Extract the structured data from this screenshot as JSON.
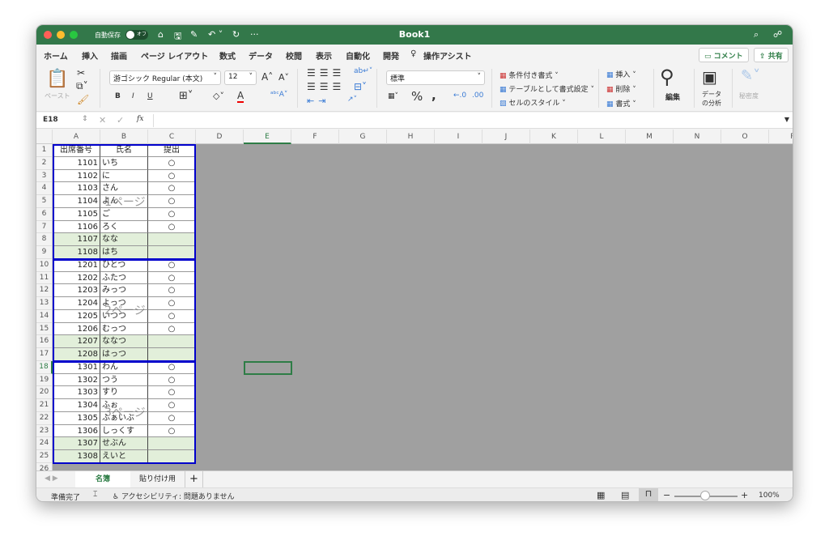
{
  "window": {
    "title": "Book1",
    "autosave_label": "自動保存",
    "autosave_state": "オフ"
  },
  "tabs": [
    "ホーム",
    "挿入",
    "描画",
    "ページ レイアウト",
    "数式",
    "データ",
    "校閲",
    "表示",
    "自動化",
    "開発",
    "操作アシスト"
  ],
  "actions": {
    "comment": "コメント",
    "share": "共有"
  },
  "ribbon": {
    "paste": "ペースト",
    "font": "游ゴシック Regular (本文)",
    "size": "12",
    "number_format": "標準",
    "conditional": "条件付き書式",
    "table": "テーブルとして書式設定",
    "cell_style": "セルのスタイル",
    "insert": "挿入",
    "delete": "削除",
    "format": "書式",
    "edit": "編集",
    "analyze1": "データ",
    "analyze2": "の分析",
    "sensitivity": "秘密度",
    "bold": "B",
    "italic": "I",
    "underline": "U"
  },
  "formula_bar": {
    "name_box": "E18",
    "fx": "fx",
    "value": ""
  },
  "columns": [
    "A",
    "B",
    "C",
    "D",
    "E",
    "F",
    "G",
    "H",
    "I",
    "J",
    "K",
    "L",
    "M",
    "N",
    "O",
    "P"
  ],
  "headers": [
    "出席番号",
    "氏名",
    "提出"
  ],
  "rows": [
    [
      "1101",
      "いち",
      "○"
    ],
    [
      "1102",
      "に",
      "○"
    ],
    [
      "1103",
      "さん",
      "○"
    ],
    [
      "1104",
      "よん",
      "○"
    ],
    [
      "1105",
      "ご",
      "○"
    ],
    [
      "1106",
      "ろく",
      "○"
    ],
    [
      "1107",
      "なな",
      ""
    ],
    [
      "1108",
      "はち",
      ""
    ],
    [
      "1201",
      "ひとつ",
      "○"
    ],
    [
      "1202",
      "ふたつ",
      "○"
    ],
    [
      "1203",
      "みっつ",
      "○"
    ],
    [
      "1204",
      "よっつ",
      "○"
    ],
    [
      "1205",
      "いつつ",
      "○"
    ],
    [
      "1206",
      "むっつ",
      "○"
    ],
    [
      "1207",
      "ななつ",
      ""
    ],
    [
      "1208",
      "はっつ",
      ""
    ],
    [
      "1301",
      "わん",
      "○"
    ],
    [
      "1302",
      "つう",
      "○"
    ],
    [
      "1303",
      "すり",
      "○"
    ],
    [
      "1304",
      "ふぉ",
      "○"
    ],
    [
      "1305",
      "ふぁいぶ",
      "○"
    ],
    [
      "1306",
      "しっくす",
      "○"
    ],
    [
      "1307",
      "せぶん",
      ""
    ],
    [
      "1308",
      "えいと",
      ""
    ]
  ],
  "page_labels": [
    "1ページ",
    "2ページ",
    "3ページ"
  ],
  "sheets": [
    "名簿",
    "貼り付け用"
  ],
  "status": {
    "ready": "準備完了",
    "accessibility": "アクセシビリティ: 問題ありません",
    "zoom": "100%",
    "zoom_percent": 100
  },
  "colors": {
    "title_bar": "#33784a",
    "page_border": "#0000cc",
    "highlight_row": "#e2efda"
  }
}
